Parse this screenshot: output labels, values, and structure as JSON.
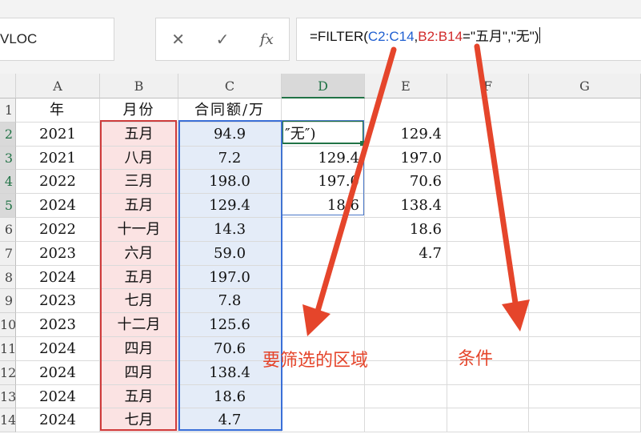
{
  "name_box": "VLOC",
  "formula_bar": {
    "buttons": {
      "cancel": "✕",
      "enter": "✓",
      "fx": "fx"
    },
    "text_before": "=FILTER(",
    "range1": "C2:C14",
    "sep1": ",",
    "range2": "B2:B14",
    "text_after": "=\"五月\",\"无\")"
  },
  "columns": [
    "A",
    "B",
    "C",
    "D",
    "E",
    "F",
    "G"
  ],
  "row_numbers": [
    "1",
    "2",
    "3",
    "4",
    "5",
    "6",
    "7",
    "8",
    "9",
    "10",
    "11",
    "12",
    "13",
    "14"
  ],
  "rows": [
    {
      "a": "年",
      "b": "月份",
      "c": "合同额/万",
      "d": "",
      "e": ""
    },
    {
      "a": "2021",
      "b": "五月",
      "c": "94.9",
      "d": "″无″)",
      "e": "129.4"
    },
    {
      "a": "2021",
      "b": "八月",
      "c": "7.2",
      "d": "129.4",
      "e": "197.0"
    },
    {
      "a": "2022",
      "b": "三月",
      "c": "198.0",
      "d": "197.0",
      "e": "70.6"
    },
    {
      "a": "2024",
      "b": "五月",
      "c": "129.4",
      "d": "18.6",
      "e": "138.4"
    },
    {
      "a": "2022",
      "b": "十一月",
      "c": "14.3",
      "d": "",
      "e": "18.6"
    },
    {
      "a": "2023",
      "b": "六月",
      "c": "59.0",
      "d": "",
      "e": "4.7"
    },
    {
      "a": "2024",
      "b": "五月",
      "c": "197.0",
      "d": "",
      "e": ""
    },
    {
      "a": "2023",
      "b": "七月",
      "c": "7.8",
      "d": "",
      "e": ""
    },
    {
      "a": "2023",
      "b": "十二月",
      "c": "125.6",
      "d": "",
      "e": ""
    },
    {
      "a": "2024",
      "b": "四月",
      "c": "70.6",
      "d": "",
      "e": ""
    },
    {
      "a": "2024",
      "b": "四月",
      "c": "138.4",
      "d": "",
      "e": ""
    },
    {
      "a": "2024",
      "b": "五月",
      "c": "18.6",
      "d": "",
      "e": ""
    },
    {
      "a": "2024",
      "b": "七月",
      "c": "4.7",
      "d": "",
      "e": ""
    }
  ],
  "annotations": {
    "range_label": "要筛选的区域",
    "condition_label": "条件"
  },
  "colors": {
    "accent_red": "#e5452b",
    "range_blue": "#3a6fd8",
    "range_red": "#cf3b3b",
    "selection_green": "#217346"
  }
}
